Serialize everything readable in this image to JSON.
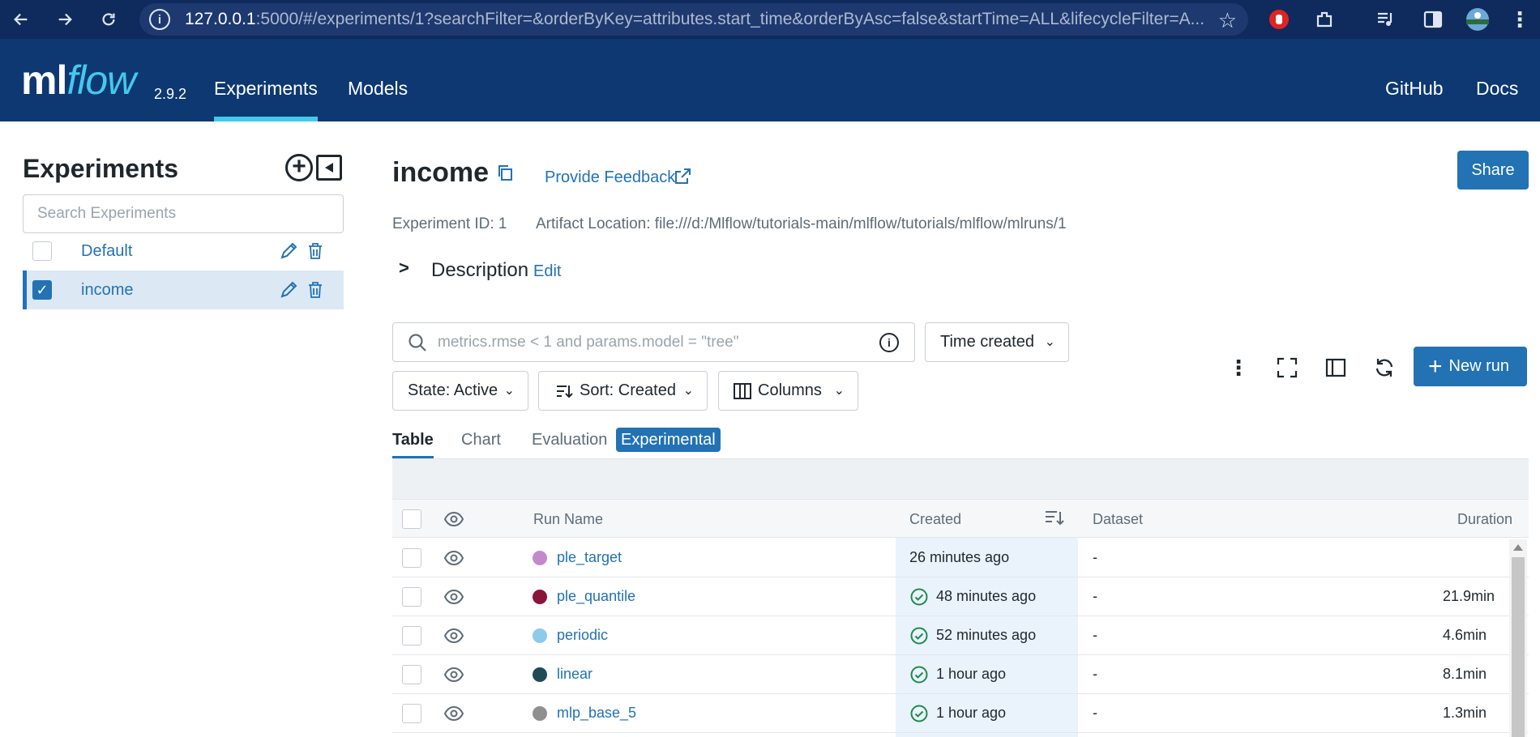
{
  "browser": {
    "url_host": "127.0.0.1",
    "url_rest": ":5000/#/experiments/1?searchFilter=&orderByKey=attributes.start_time&orderByAsc=false&startTime=ALL&lifecycleFilter=A..."
  },
  "header": {
    "logo_ml": "ml",
    "logo_flow": "flow",
    "version": "2.9.2",
    "nav": [
      "Experiments",
      "Models"
    ],
    "right_links": [
      "GitHub",
      "Docs"
    ]
  },
  "sidebar": {
    "title": "Experiments",
    "search_placeholder": "Search Experiments",
    "experiments": [
      {
        "name": "Default",
        "checked": false
      },
      {
        "name": "income",
        "checked": true
      }
    ]
  },
  "main": {
    "title": "income",
    "feedback": "Provide Feedback",
    "share": "Share",
    "experiment_id": "Experiment ID: 1",
    "artifact_location": "Artifact Location: file:///d:/Mlflow/tutorials-main/mlflow/tutorials/mlflow/mlruns/1",
    "description": "Description",
    "edit": "Edit",
    "filter_placeholder": "metrics.rmse < 1 and params.model = \"tree\"",
    "time_created": "Time created",
    "state": "State: Active",
    "sort": "Sort: Created",
    "columns": "Columns",
    "new_run": "New run",
    "tabs": [
      "Table",
      "Chart",
      "Evaluation"
    ],
    "badge": "Experimental"
  },
  "table": {
    "headers": [
      "Run Name",
      "Created",
      "Dataset",
      "Duration"
    ],
    "rows": [
      {
        "name": "ple_target",
        "color": "#c38ac9",
        "created": "26 minutes ago",
        "finished": false,
        "dataset": "-",
        "duration": ""
      },
      {
        "name": "ple_quantile",
        "color": "#8a1538",
        "created": "48 minutes ago",
        "finished": true,
        "dataset": "-",
        "duration": "21.9min"
      },
      {
        "name": "periodic",
        "color": "#8ccbe9",
        "created": "52 minutes ago",
        "finished": true,
        "dataset": "-",
        "duration": "4.6min"
      },
      {
        "name": "linear",
        "color": "#1f4a58",
        "created": "1 hour ago",
        "finished": true,
        "dataset": "-",
        "duration": "8.1min"
      },
      {
        "name": "mlp_base_5",
        "color": "#8f8f8f",
        "created": "1 hour ago",
        "finished": true,
        "dataset": "-",
        "duration": "1.3min"
      }
    ]
  },
  "colors": {
    "primary": "#2272b4",
    "header_bg": "#0d3871",
    "browser_bg": "#0f2a5c",
    "accent": "#43c9ed",
    "success": "#1f8a4c"
  }
}
